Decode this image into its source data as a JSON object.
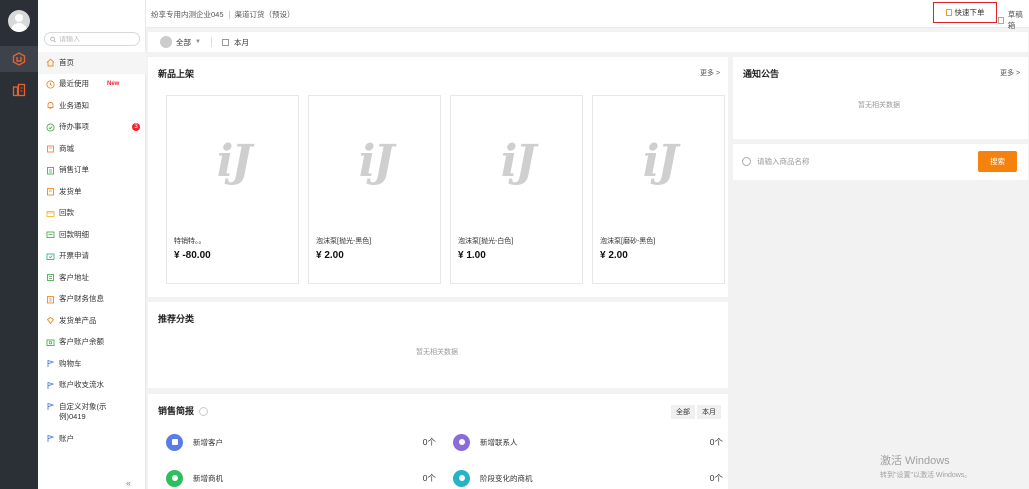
{
  "header": {
    "company": "纷享专用内测企业045",
    "scope": "渠道订货（预设）",
    "quick_order": "快速下单",
    "draft": "草稿箱"
  },
  "sidebar": {
    "search_placeholder": "请输入",
    "items": [
      {
        "label": "首页",
        "icon": "home-icon"
      },
      {
        "label": "最近使用",
        "icon": "clock-icon",
        "tag": "New"
      },
      {
        "label": "业务通知",
        "icon": "bell-icon"
      },
      {
        "label": "待办事项",
        "icon": "check-circle-icon",
        "badge": "3"
      },
      {
        "label": "商城",
        "icon": "shop-icon"
      },
      {
        "label": "销售订单",
        "icon": "order-icon"
      },
      {
        "label": "发货单",
        "icon": "delivery-icon"
      },
      {
        "label": "回款",
        "icon": "payment-icon"
      },
      {
        "label": "回款明细",
        "icon": "payment-detail-icon"
      },
      {
        "label": "开票申请",
        "icon": "invoice-icon"
      },
      {
        "label": "客户地址",
        "icon": "address-icon"
      },
      {
        "label": "客户财务信息",
        "icon": "finance-icon"
      },
      {
        "label": "发货单产品",
        "icon": "product-icon"
      },
      {
        "label": "客户账户余额",
        "icon": "balance-icon"
      },
      {
        "label": "购物车",
        "icon": "flag-icon"
      },
      {
        "label": "账户收支流水",
        "icon": "flag-icon"
      },
      {
        "label": "自定义对象(示例)0419",
        "icon": "flag-icon"
      },
      {
        "label": "账户",
        "icon": "flag-icon"
      }
    ],
    "collapse": "«"
  },
  "filter": {
    "user": "全部",
    "period": "本月"
  },
  "new_products": {
    "title": "新品上架",
    "more": "更多 >",
    "logo_text": "iJ",
    "products": [
      {
        "name": "特销特。。",
        "price": "¥ -80.00"
      },
      {
        "name": "泡沫泵[抛光-黑色]",
        "price": "¥ 2.00"
      },
      {
        "name": "泡沫泵[抛光-白色]",
        "price": "¥ 1.00"
      },
      {
        "name": "泡沫泵[磨砂-黑色]",
        "price": "¥ 2.00"
      }
    ]
  },
  "recommend": {
    "title": "推荐分类",
    "empty": "暂无相关数据"
  },
  "sales": {
    "title": "销售简报",
    "segments": [
      "全部",
      "本月"
    ],
    "stats": [
      {
        "label": "新增客户",
        "value": "0个",
        "color": "#5b7ce6"
      },
      {
        "label": "新增联系人",
        "value": "0个",
        "color": "#8a6bd9"
      },
      {
        "label": "新增商机",
        "value": "0个",
        "color": "#2cbf5e"
      },
      {
        "label": "阶段变化的商机",
        "value": "0个",
        "color": "#25b3c5"
      }
    ]
  },
  "notice": {
    "title": "通知公告",
    "more": "更多 >",
    "empty": "暂无相关数据"
  },
  "product_search": {
    "placeholder": "请输入商品名称",
    "button": "搜索"
  },
  "watermark": {
    "line1": "激活 Windows",
    "line2": "转到\"设置\"以激活 Windows。"
  },
  "colors": {
    "accent": "#f5820d",
    "rail": "#2b2f36",
    "highlight_border": "#e02020"
  }
}
